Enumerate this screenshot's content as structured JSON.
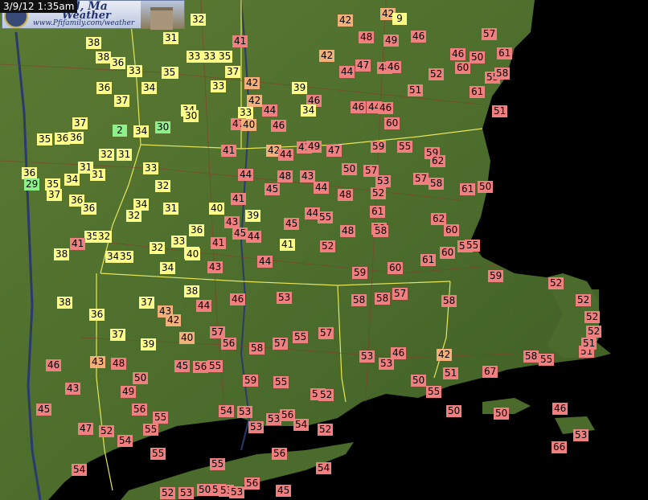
{
  "timestamp": "3/9/12 1:35am",
  "logo": {
    "title_line1": "ford, Ma",
    "title_line2": "Weather",
    "url": "www.Pfifamily.com/weather"
  },
  "colors": {
    "warm": "#f07f7f",
    "mild": "#f4b07a",
    "cool": "#fdfd8a",
    "cold": "#8ef08a",
    "ocean": "#000000",
    "land": "#4f6e2e",
    "state_border": "#e6e65a"
  },
  "temperature_units": "°F",
  "temperatures": [
    {
      "v": "32",
      "c": "yellow"
    },
    {
      "v": "31",
      "c": "yellow"
    },
    {
      "v": "41",
      "c": "pink"
    },
    {
      "v": "42",
      "c": "orange"
    },
    {
      "v": "42",
      "c": "orange"
    },
    {
      "v": "9",
      "c": "yellow"
    },
    {
      "v": "48",
      "c": "pink"
    },
    {
      "v": "49",
      "c": "pink"
    },
    {
      "v": "46",
      "c": "pink"
    },
    {
      "v": "57",
      "c": "pink"
    },
    {
      "v": "38",
      "c": "yellow"
    },
    {
      "v": "38",
      "c": "yellow"
    },
    {
      "v": "36",
      "c": "yellow"
    },
    {
      "v": "33",
      "c": "yellow"
    },
    {
      "v": "35",
      "c": "yellow"
    },
    {
      "v": "33",
      "c": "yellow"
    },
    {
      "v": "33",
      "c": "yellow"
    },
    {
      "v": "35",
      "c": "yellow"
    },
    {
      "v": "37",
      "c": "yellow"
    },
    {
      "v": "42",
      "c": "orange"
    },
    {
      "v": "42",
      "c": "orange"
    },
    {
      "v": "44",
      "c": "pink"
    },
    {
      "v": "47",
      "c": "pink"
    },
    {
      "v": "48",
      "c": "pink"
    },
    {
      "v": "46",
      "c": "pink"
    },
    {
      "v": "52",
      "c": "pink"
    },
    {
      "v": "46",
      "c": "pink"
    },
    {
      "v": "50",
      "c": "pink"
    },
    {
      "v": "61",
      "c": "pink"
    },
    {
      "v": "60",
      "c": "pink"
    },
    {
      "v": "55",
      "c": "pink"
    },
    {
      "v": "58",
      "c": "pink"
    },
    {
      "v": "36",
      "c": "yellow"
    },
    {
      "v": "34",
      "c": "yellow"
    },
    {
      "v": "35",
      "c": "yellow"
    },
    {
      "v": "33",
      "c": "yellow"
    },
    {
      "v": "39",
      "c": "yellow"
    },
    {
      "v": "42",
      "c": "orange"
    },
    {
      "v": "46",
      "c": "pink"
    },
    {
      "v": "51",
      "c": "pink"
    },
    {
      "v": "61",
      "c": "pink"
    },
    {
      "v": "37",
      "c": "yellow"
    },
    {
      "v": "34",
      "c": "yellow"
    },
    {
      "v": "30",
      "c": "yellow"
    },
    {
      "v": "33",
      "c": "yellow"
    },
    {
      "v": "44",
      "c": "pink"
    },
    {
      "v": "47",
      "c": "pink"
    },
    {
      "v": "40",
      "c": "orange"
    },
    {
      "v": "46",
      "c": "pink"
    },
    {
      "v": "34",
      "c": "yellow"
    },
    {
      "v": "46",
      "c": "pink"
    },
    {
      "v": "44",
      "c": "pink"
    },
    {
      "v": "46",
      "c": "pink"
    },
    {
      "v": "60",
      "c": "pink"
    },
    {
      "v": "51",
      "c": "pink"
    },
    {
      "v": "37",
      "c": "yellow"
    },
    {
      "v": "2",
      "c": "green"
    },
    {
      "v": "34",
      "c": "yellow"
    },
    {
      "v": "30",
      "c": "green"
    },
    {
      "v": "36",
      "c": "yellow"
    },
    {
      "v": "35",
      "c": "yellow"
    },
    {
      "v": "36",
      "c": "yellow"
    },
    {
      "v": "32",
      "c": "yellow"
    },
    {
      "v": "31",
      "c": "yellow"
    },
    {
      "v": "33",
      "c": "yellow"
    },
    {
      "v": "41",
      "c": "pink"
    },
    {
      "v": "42",
      "c": "orange"
    },
    {
      "v": "41",
      "c": "pink"
    },
    {
      "v": "49",
      "c": "pink"
    },
    {
      "v": "44",
      "c": "pink"
    },
    {
      "v": "47",
      "c": "pink"
    },
    {
      "v": "59",
      "c": "pink"
    },
    {
      "v": "55",
      "c": "pink"
    },
    {
      "v": "59",
      "c": "pink"
    },
    {
      "v": "62",
      "c": "pink"
    },
    {
      "v": "36",
      "c": "yellow"
    },
    {
      "v": "35",
      "c": "yellow"
    },
    {
      "v": "34",
      "c": "yellow"
    },
    {
      "v": "31",
      "c": "yellow"
    },
    {
      "v": "31",
      "c": "yellow"
    },
    {
      "v": "29",
      "c": "green"
    },
    {
      "v": "37",
      "c": "yellow"
    },
    {
      "v": "36",
      "c": "yellow"
    },
    {
      "v": "32",
      "c": "yellow"
    },
    {
      "v": "36",
      "c": "yellow"
    },
    {
      "v": "44",
      "c": "pink"
    },
    {
      "v": "41",
      "c": "pink"
    },
    {
      "v": "48",
      "c": "pink"
    },
    {
      "v": "43",
      "c": "pink"
    },
    {
      "v": "50",
      "c": "pink"
    },
    {
      "v": "57",
      "c": "pink"
    },
    {
      "v": "53",
      "c": "pink"
    },
    {
      "v": "57",
      "c": "pink"
    },
    {
      "v": "61",
      "c": "pink"
    },
    {
      "v": "50",
      "c": "pink"
    },
    {
      "v": "45",
      "c": "pink"
    },
    {
      "v": "44",
      "c": "pink"
    },
    {
      "v": "48",
      "c": "pink"
    },
    {
      "v": "52",
      "c": "pink"
    },
    {
      "v": "58",
      "c": "pink"
    },
    {
      "v": "34",
      "c": "yellow"
    },
    {
      "v": "32",
      "c": "yellow"
    },
    {
      "v": "31",
      "c": "yellow"
    },
    {
      "v": "40",
      "c": "yellow"
    },
    {
      "v": "39",
      "c": "yellow"
    },
    {
      "v": "45",
      "c": "pink"
    },
    {
      "v": "44",
      "c": "pink"
    },
    {
      "v": "55",
      "c": "pink"
    },
    {
      "v": "61",
      "c": "pink"
    },
    {
      "v": "62",
      "c": "pink"
    },
    {
      "v": "35",
      "c": "yellow"
    },
    {
      "v": "32",
      "c": "yellow"
    },
    {
      "v": "41",
      "c": "pink"
    },
    {
      "v": "36",
      "c": "yellow"
    },
    {
      "v": "43",
      "c": "pink"
    },
    {
      "v": "45",
      "c": "pink"
    },
    {
      "v": "44",
      "c": "pink"
    },
    {
      "v": "48",
      "c": "pink"
    },
    {
      "v": "58",
      "c": "pink"
    },
    {
      "v": "60",
      "c": "pink"
    },
    {
      "v": "38",
      "c": "yellow"
    },
    {
      "v": "40",
      "c": "yellow"
    },
    {
      "v": "32",
      "c": "yellow"
    },
    {
      "v": "33",
      "c": "yellow"
    },
    {
      "v": "40",
      "c": "yellow"
    },
    {
      "v": "41",
      "c": "pink"
    },
    {
      "v": "41",
      "c": "yellow"
    },
    {
      "v": "52",
      "c": "pink"
    },
    {
      "v": "58",
      "c": "pink"
    },
    {
      "v": "58",
      "c": "pink"
    },
    {
      "v": "34",
      "c": "yellow"
    },
    {
      "v": "35",
      "c": "yellow"
    },
    {
      "v": "34",
      "c": "yellow"
    },
    {
      "v": "43",
      "c": "pink"
    },
    {
      "v": "44",
      "c": "pink"
    },
    {
      "v": "59",
      "c": "pink"
    },
    {
      "v": "60",
      "c": "pink"
    },
    {
      "v": "61",
      "c": "pink"
    },
    {
      "v": "60",
      "c": "pink"
    },
    {
      "v": "55",
      "c": "pink"
    },
    {
      "v": "59",
      "c": "pink"
    },
    {
      "v": "52",
      "c": "pink"
    },
    {
      "v": "38",
      "c": "yellow"
    },
    {
      "v": "36",
      "c": "yellow"
    },
    {
      "v": "37",
      "c": "yellow"
    },
    {
      "v": "38",
      "c": "yellow"
    },
    {
      "v": "43",
      "c": "orange"
    },
    {
      "v": "44",
      "c": "pink"
    },
    {
      "v": "46",
      "c": "pink"
    },
    {
      "v": "53",
      "c": "pink"
    },
    {
      "v": "58",
      "c": "pink"
    },
    {
      "v": "58",
      "c": "pink"
    },
    {
      "v": "57",
      "c": "pink"
    },
    {
      "v": "58",
      "c": "pink"
    },
    {
      "v": "52",
      "c": "pink"
    },
    {
      "v": "52",
      "c": "pink"
    },
    {
      "v": "37",
      "c": "yellow"
    },
    {
      "v": "39",
      "c": "yellow"
    },
    {
      "v": "42",
      "c": "orange"
    },
    {
      "v": "40",
      "c": "orange"
    },
    {
      "v": "57",
      "c": "pink"
    },
    {
      "v": "56",
      "c": "pink"
    },
    {
      "v": "58",
      "c": "pink"
    },
    {
      "v": "57",
      "c": "pink"
    },
    {
      "v": "55",
      "c": "pink"
    },
    {
      "v": "57",
      "c": "pink"
    },
    {
      "v": "53",
      "c": "pink"
    },
    {
      "v": "53",
      "c": "pink"
    },
    {
      "v": "46",
      "c": "pink"
    },
    {
      "v": "42",
      "c": "orange"
    },
    {
      "v": "43",
      "c": "orange"
    },
    {
      "v": "48",
      "c": "pink"
    },
    {
      "v": "50",
      "c": "pink"
    },
    {
      "v": "45",
      "c": "pink"
    },
    {
      "v": "56",
      "c": "pink"
    },
    {
      "v": "55",
      "c": "pink"
    },
    {
      "v": "59",
      "c": "pink"
    },
    {
      "v": "55",
      "c": "pink"
    },
    {
      "v": "56",
      "c": "pink"
    },
    {
      "v": "51",
      "c": "pink"
    },
    {
      "v": "46",
      "c": "pink"
    },
    {
      "v": "43",
      "c": "pink"
    },
    {
      "v": "49",
      "c": "pink"
    },
    {
      "v": "56",
      "c": "pink"
    },
    {
      "v": "55",
      "c": "pink"
    },
    {
      "v": "54",
      "c": "pink"
    },
    {
      "v": "53",
      "c": "pink"
    },
    {
      "v": "56",
      "c": "pink"
    },
    {
      "v": "52",
      "c": "pink"
    },
    {
      "v": "55",
      "c": "pink"
    },
    {
      "v": "45",
      "c": "pink"
    },
    {
      "v": "47",
      "c": "pink"
    },
    {
      "v": "52",
      "c": "pink"
    },
    {
      "v": "54",
      "c": "pink"
    },
    {
      "v": "55",
      "c": "pink"
    },
    {
      "v": "53",
      "c": "pink"
    },
    {
      "v": "53",
      "c": "pink"
    },
    {
      "v": "54",
      "c": "pink"
    },
    {
      "v": "52",
      "c": "pink"
    },
    {
      "v": "50",
      "c": "pink"
    },
    {
      "v": "50",
      "c": "pink"
    },
    {
      "v": "50",
      "c": "pink"
    },
    {
      "v": "46",
      "c": "pink"
    },
    {
      "v": "66",
      "c": "pink"
    },
    {
      "v": "53",
      "c": "pink"
    },
    {
      "v": "54",
      "c": "pink"
    },
    {
      "v": "55",
      "c": "pink"
    },
    {
      "v": "56",
      "c": "pink"
    },
    {
      "v": "55",
      "c": "pink"
    },
    {
      "v": "54",
      "c": "pink"
    },
    {
      "v": "56",
      "c": "pink"
    },
    {
      "v": "54",
      "c": "pink"
    },
    {
      "v": "52",
      "c": "pink"
    },
    {
      "v": "53",
      "c": "pink"
    },
    {
      "v": "50",
      "c": "pink"
    },
    {
      "v": "53",
      "c": "pink"
    },
    {
      "v": "53",
      "c": "pink"
    },
    {
      "v": "45",
      "c": "pink"
    },
    {
      "v": "67",
      "c": "pink"
    },
    {
      "v": "51",
      "c": "pink"
    },
    {
      "v": "51",
      "c": "pink"
    },
    {
      "v": "58",
      "c": "pink"
    },
    {
      "v": "55",
      "c": "pink"
    },
    {
      "v": "52",
      "c": "pink"
    }
  ]
}
